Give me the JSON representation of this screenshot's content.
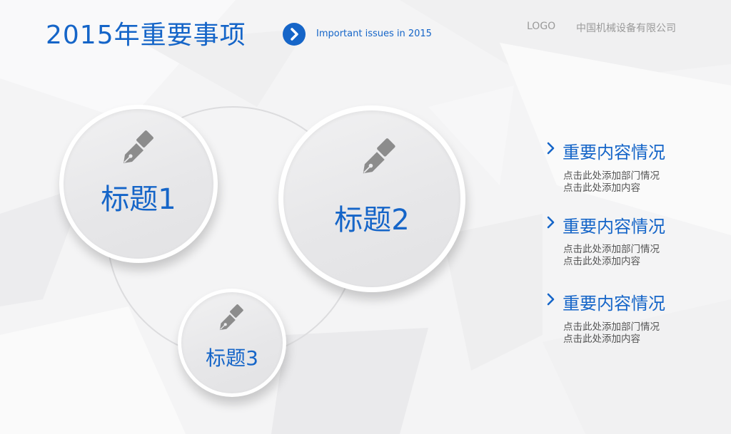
{
  "header": {
    "title": "2015年重要事项",
    "subtitle": "Important issues in 2015",
    "logo": "LOGO",
    "company": "中国机械设备有限公司",
    "icon": "chevron-right-icon"
  },
  "circles": [
    {
      "label": "标题1",
      "icon": "pen-nib-icon"
    },
    {
      "label": "标题2",
      "icon": "pen-nib-icon"
    },
    {
      "label": "标题3",
      "icon": "pen-nib-icon"
    }
  ],
  "items": [
    {
      "title": "重要内容情况",
      "line1": "点击此处添加部门情况",
      "line2": "点击此处添加内容"
    },
    {
      "title": "重要内容情况",
      "line1": "点击此处添加部门情况",
      "line2": "点击此处添加内容"
    },
    {
      "title": "重要内容情况",
      "line1": "点击此处添加部门情况",
      "line2": "点击此处添加内容"
    }
  ],
  "colors": {
    "accent": "#1565c8",
    "text_gray": "#555555",
    "muted": "#9a9a9a"
  }
}
